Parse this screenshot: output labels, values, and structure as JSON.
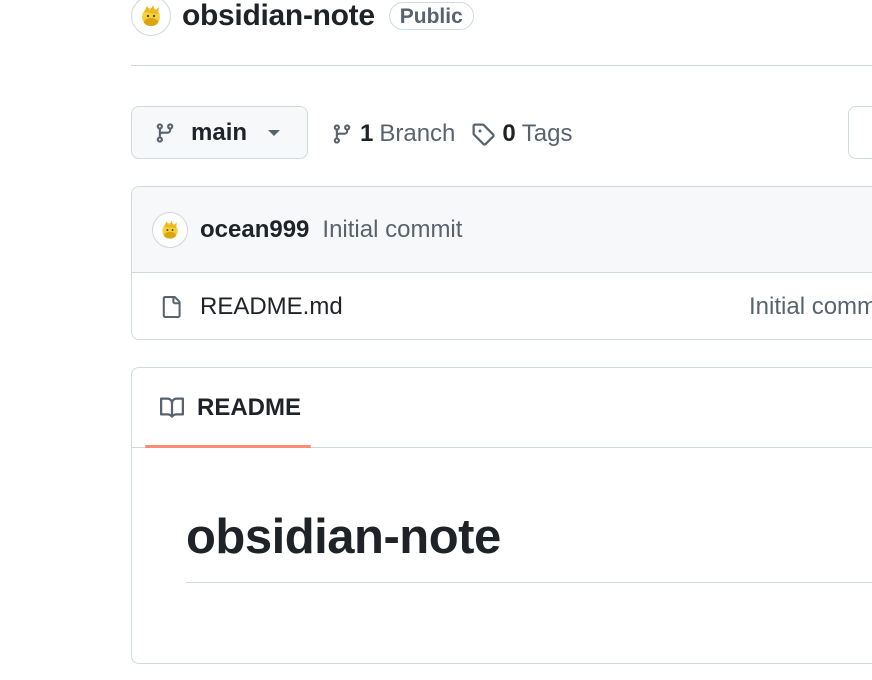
{
  "repo": {
    "name": "obsidian-note",
    "visibility": "Public"
  },
  "toolbar": {
    "branch": "main",
    "branch_count": "1",
    "branch_label": "Branch",
    "tag_count": "0",
    "tag_label": "Tags"
  },
  "latest_commit": {
    "author": "ocean999",
    "message": "Initial commit"
  },
  "files": [
    {
      "name": "README.md",
      "commit_message": "Initial comm",
      "icon": "file-icon"
    }
  ],
  "readme": {
    "tab_label": "README",
    "heading": "obsidian-note"
  },
  "colors": {
    "accent_underline": "#fd8c73",
    "muted_text": "#59636e",
    "border": "#d1d9e0"
  }
}
